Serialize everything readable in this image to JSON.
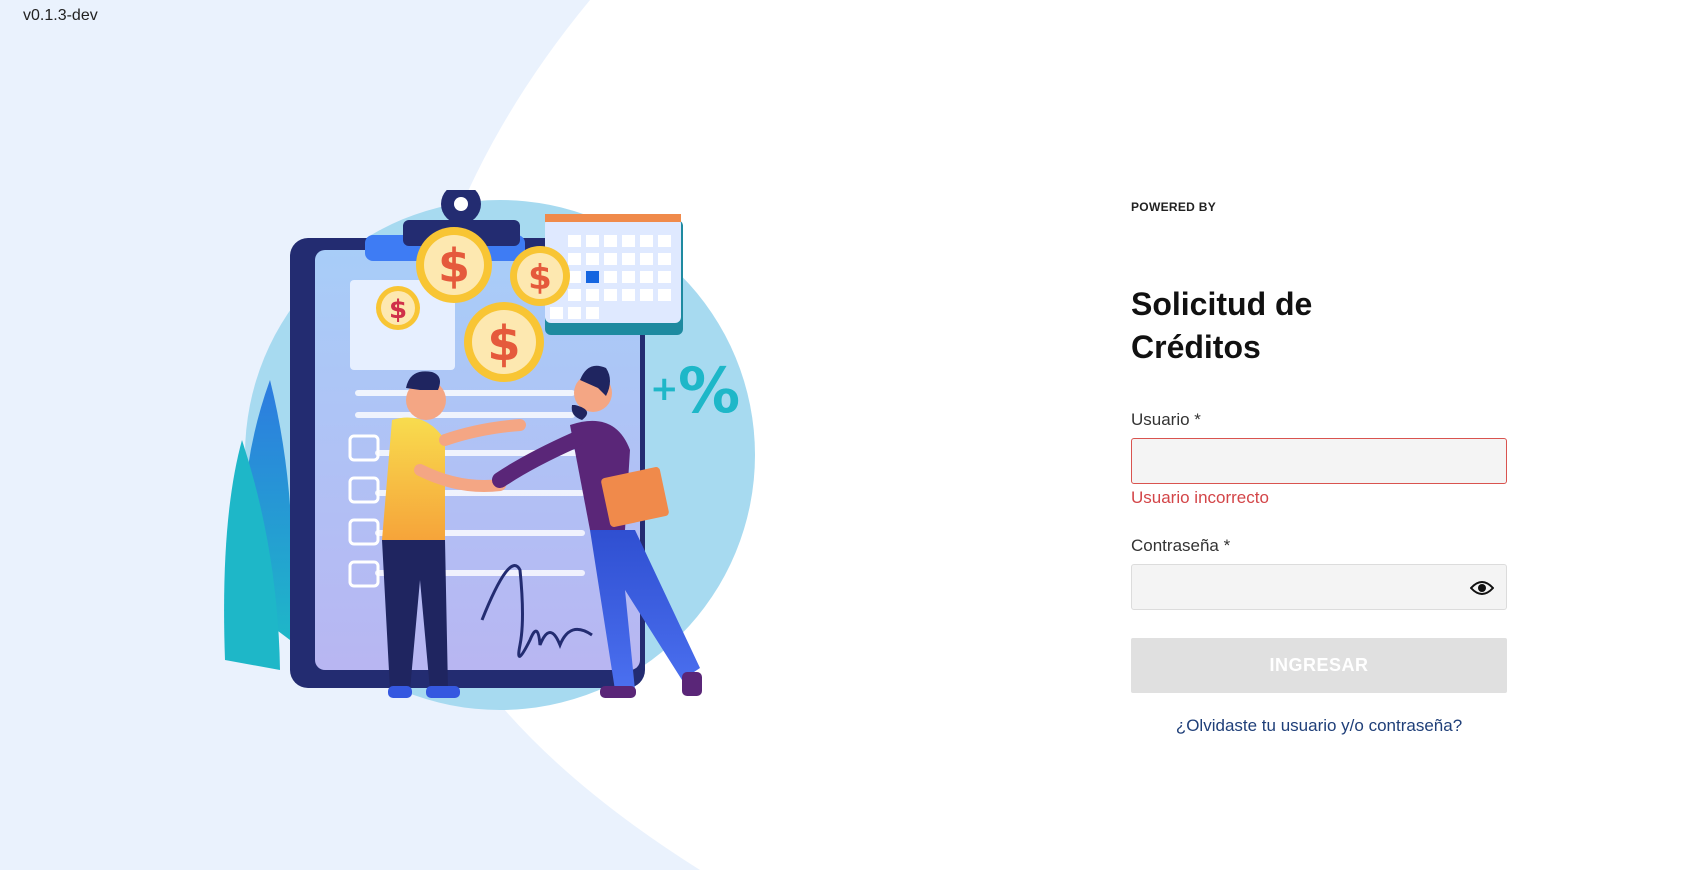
{
  "app": {
    "version": "v0.1.3-dev"
  },
  "login": {
    "powered_by": "POWERED BY",
    "title_line1": "Solicitud de",
    "title_line2": "Créditos",
    "username_label": "Usuario *",
    "username_value": "",
    "username_error": "Usuario incorrecto",
    "password_label": "Contraseña *",
    "password_value": "",
    "submit_label": "INGRESAR",
    "forgot_link": "¿Olvidaste tu usuario y/o contraseña?"
  },
  "icons": {
    "password_toggle": "eye-icon"
  },
  "colors": {
    "error": "#d34548",
    "link": "#1f3f79",
    "button_disabled": "#e0e0e0",
    "background_shape": "#eaf2fd"
  }
}
